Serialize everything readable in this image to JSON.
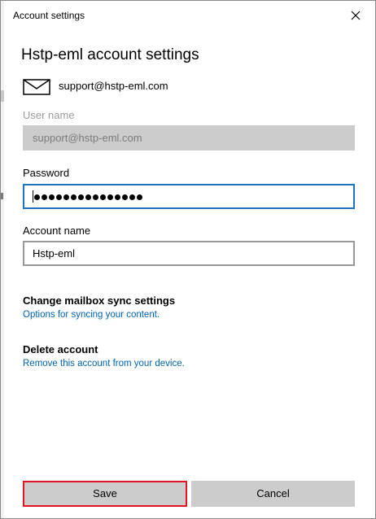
{
  "window": {
    "title": "Account settings",
    "close_icon": "close-icon"
  },
  "heading": "Hstp-eml account settings",
  "account": {
    "icon": "mail-icon",
    "email": "support@hstp-eml.com"
  },
  "username": {
    "label": "User name",
    "value": "support@hstp-eml.com"
  },
  "password": {
    "label": "Password",
    "mask_count": 15
  },
  "account_name": {
    "label": "Account name",
    "value": "Hstp-eml"
  },
  "sync": {
    "title": "Change mailbox sync settings",
    "link": "Options for syncing your content."
  },
  "delete": {
    "title": "Delete account",
    "link": "Remove this account from your device."
  },
  "buttons": {
    "save": "Save",
    "cancel": "Cancel"
  },
  "colors": {
    "accent": "#0063b1",
    "focus_border": "#1f6fc5",
    "save_highlight": "#e81123",
    "button_bg": "#cccccc"
  }
}
